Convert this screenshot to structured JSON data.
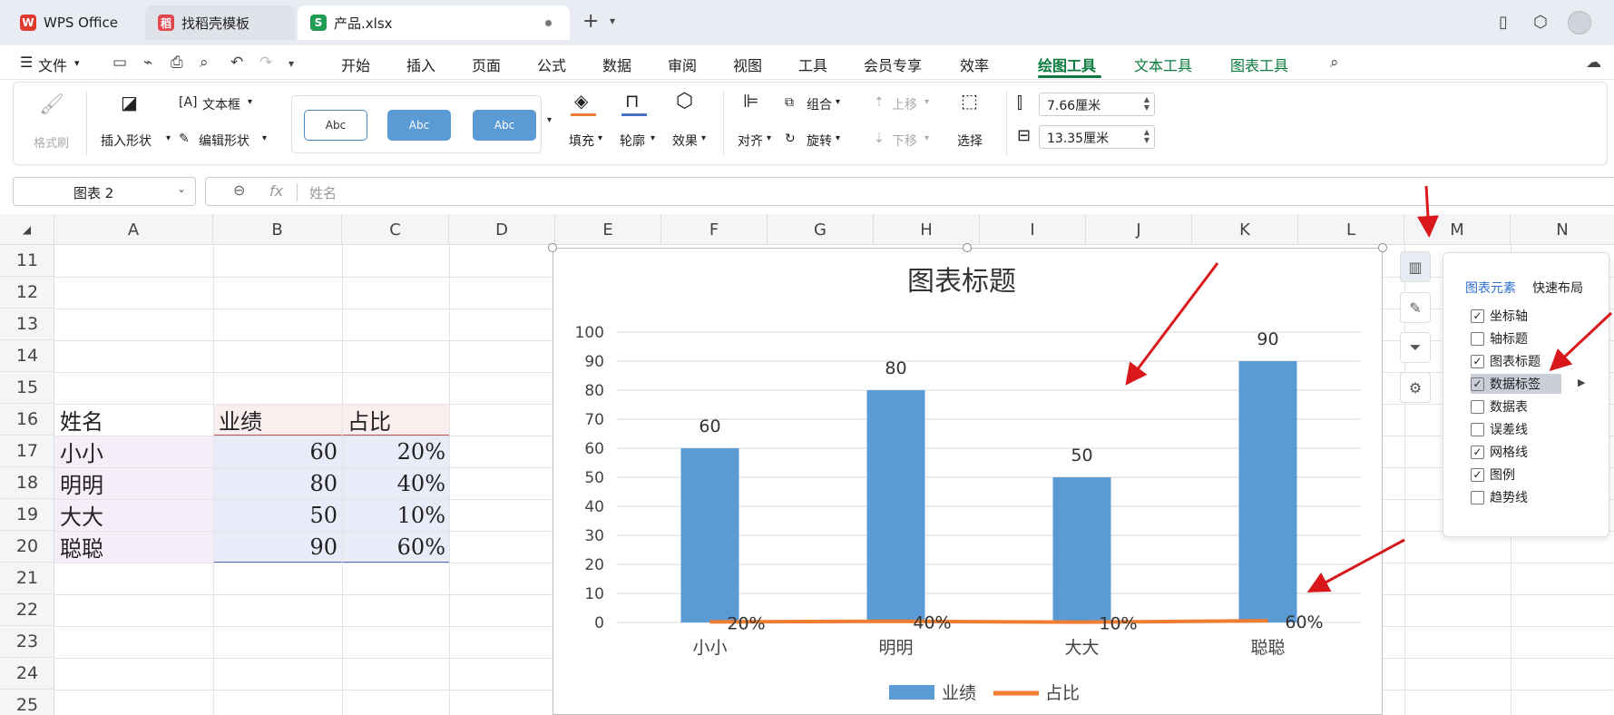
{
  "tabs": [
    {
      "label": "WPS Office",
      "icon": "wps-logo-icon",
      "color": "#e03a2c"
    },
    {
      "label": "找稻壳模板",
      "icon": "docer-logo-icon",
      "color": "#e2474e"
    },
    {
      "label": "产品.xlsx",
      "icon": "spreadsheet-icon",
      "color": "#1f9d55"
    }
  ],
  "menu": {
    "file": "文件",
    "items": [
      "开始",
      "插入",
      "页面",
      "公式",
      "数据",
      "审阅",
      "视图",
      "工具",
      "会员专享",
      "效率"
    ],
    "context_tabs": [
      "绘图工具",
      "文本工具",
      "图表工具"
    ],
    "accent": "#0a7a3d"
  },
  "ribbon": {
    "format_painter": "格式刷",
    "insert_shape": "插入形状",
    "text_box": "文本框",
    "edit_shape": "编辑形状",
    "style_samples": [
      "Abc",
      "Abc",
      "Abc"
    ],
    "fill": "填充",
    "outline": "轮廓",
    "effect": "效果",
    "align": "对齐",
    "group": "组合",
    "rotate": "旋转",
    "bring_forward": "上移",
    "send_backward": "下移",
    "select": "选择",
    "height": "7.66厘米",
    "width": "13.35厘米"
  },
  "formula": {
    "name_box": "图表 2",
    "fx": "fx",
    "value": "姓名"
  },
  "columns": [
    "A",
    "B",
    "C",
    "D",
    "E",
    "F",
    "G",
    "H",
    "I",
    "J",
    "K",
    "L",
    "M",
    "N"
  ],
  "rows": [
    "11",
    "12",
    "13",
    "14",
    "15",
    "16",
    "17",
    "18",
    "19",
    "20",
    "21",
    "22",
    "23",
    "24",
    "25"
  ],
  "table": {
    "headers": [
      "姓名",
      "业绩",
      "占比"
    ],
    "rows": [
      {
        "name": "小小",
        "score": "60",
        "ratio": "20%"
      },
      {
        "name": "明明",
        "score": "80",
        "ratio": "40%"
      },
      {
        "name": "大大",
        "score": "50",
        "ratio": "10%"
      },
      {
        "name": "聪聪",
        "score": "90",
        "ratio": "60%"
      }
    ]
  },
  "chart_data": {
    "type": "bar",
    "title": "图表标题",
    "categories": [
      "小小",
      "明明",
      "大大",
      "聪聪"
    ],
    "series": [
      {
        "name": "业绩",
        "type": "bar",
        "values": [
          60,
          80,
          50,
          90
        ],
        "labels": [
          "60",
          "80",
          "50",
          "90"
        ],
        "color": "#5b9bd5"
      },
      {
        "name": "占比",
        "type": "line",
        "values": [
          0.2,
          0.4,
          0.1,
          0.6
        ],
        "labels": [
          "20%",
          "40%",
          "10%",
          "60%"
        ],
        "color": "#ed7d31"
      }
    ],
    "ylim": [
      0,
      100
    ],
    "yticks": [
      "0",
      "10",
      "20",
      "30",
      "40",
      "50",
      "60",
      "70",
      "80",
      "90",
      "100"
    ],
    "grid": true,
    "legend": "bottom"
  },
  "panel": {
    "tabs": [
      "图表元素",
      "快速布局"
    ],
    "items": [
      {
        "label": "坐标轴",
        "checked": true
      },
      {
        "label": "轴标题",
        "checked": false
      },
      {
        "label": "图表标题",
        "checked": true
      },
      {
        "label": "数据标签",
        "checked": true
      },
      {
        "label": "数据表",
        "checked": false
      },
      {
        "label": "误差线",
        "checked": false
      },
      {
        "label": "网格线",
        "checked": true
      },
      {
        "label": "图例",
        "checked": true
      },
      {
        "label": "趋势线",
        "checked": false
      }
    ]
  },
  "annotation_color": "#d9181c"
}
